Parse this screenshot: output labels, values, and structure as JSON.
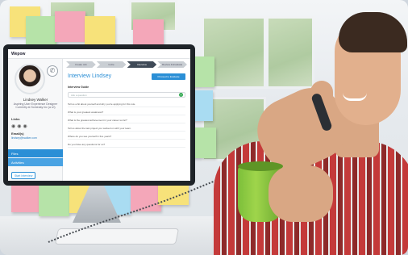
{
  "app": {
    "title": "Wepow"
  },
  "candidate": {
    "name": "Lindsey Walker",
    "role_line1": "Aspiring User Experience Designer",
    "role_line2": "Currently at Someday Inc (a UI)",
    "links_label": "Links",
    "email_label": "Email(s)",
    "email_value": "lindsey@walker.com"
  },
  "sidebar": {
    "items": [
      "Files",
      "Activities"
    ],
    "button_label": "Start Interview"
  },
  "steps": [
    "Create Job",
    "Invite",
    "Interview",
    "Review & Evaluate"
  ],
  "main": {
    "title": "Interview Lindsey",
    "cta_label": "Proceed to Evaluate",
    "questions_heading": "Interview Guide",
    "search_placeholder": "Ask a question",
    "questions": [
      "Tell us a bit about yourself and why you're applying for this role.",
      "What is your greatest weakness?",
      "What is the greatest achievement in your career so far?",
      "Tell us about the last project you worked on with your team.",
      "Where do you see yourself in five years?",
      "Do you have any questions for us?"
    ]
  },
  "colors": {
    "accent": "#2b8fd6",
    "active_step": "#3f4a57",
    "add_icon": "#34a853",
    "notes": [
      "#f7e27a",
      "#f4a7b9",
      "#b6e3a8",
      "#a9dcf2"
    ]
  }
}
